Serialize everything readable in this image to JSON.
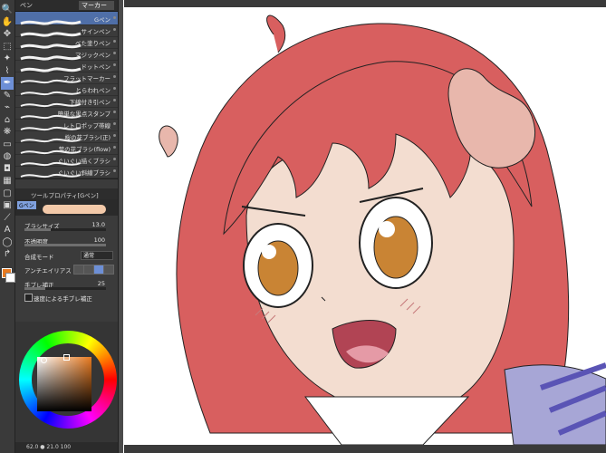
{
  "tools": [
    {
      "icon": "zoom-icon",
      "glyph": "🔍"
    },
    {
      "icon": "hand-icon",
      "glyph": "✋"
    },
    {
      "icon": "move-icon",
      "glyph": "✥"
    },
    {
      "icon": "select-icon",
      "glyph": "⬚"
    },
    {
      "icon": "wand-icon",
      "glyph": "✦"
    },
    {
      "icon": "eyedropper-icon",
      "glyph": "⌇"
    },
    {
      "icon": "pen-icon",
      "glyph": "✒"
    },
    {
      "icon": "pencil-icon",
      "glyph": "✎"
    },
    {
      "icon": "brush-icon",
      "glyph": "⌁"
    },
    {
      "icon": "airbrush-icon",
      "glyph": "⌂"
    },
    {
      "icon": "decoration-icon",
      "glyph": "❋"
    },
    {
      "icon": "eraser-icon",
      "glyph": "▭"
    },
    {
      "icon": "blend-icon",
      "glyph": "◍"
    },
    {
      "icon": "fill-icon",
      "glyph": "◘"
    },
    {
      "icon": "gradient-icon",
      "glyph": "▦"
    },
    {
      "icon": "figure-icon",
      "glyph": "▢"
    },
    {
      "icon": "frame-icon",
      "glyph": "▣"
    },
    {
      "icon": "ruler-icon",
      "glyph": "⟋"
    },
    {
      "icon": "text-icon",
      "glyph": "A"
    },
    {
      "icon": "balloon-icon",
      "glyph": "◯"
    },
    {
      "icon": "correct-line-icon",
      "glyph": "↱"
    }
  ],
  "brush_panel": {
    "tabs": [
      "ペン",
      "マーカー"
    ],
    "brushes": [
      {
        "label": "Gペン"
      },
      {
        "label": "サインペン"
      },
      {
        "label": "べた塗りペン"
      },
      {
        "label": "マジックペン"
      },
      {
        "label": "ドットペン"
      },
      {
        "label": "フラットマーカー"
      },
      {
        "label": "とらわれペン"
      },
      {
        "label": "下線付き引ペン"
      },
      {
        "label": "簡単な黒点スタンプ"
      },
      {
        "label": "レトロポップ帯線"
      },
      {
        "label": "桜の花ブラシ(正)"
      },
      {
        "label": "葉の花ブラシ(flow)"
      },
      {
        "label": "ぐいぐい描くブラシ"
      },
      {
        "label": "ぐいぐい斜線ブラシ"
      }
    ]
  },
  "tool_property": {
    "header": "ツールプロパティ[Gペン]",
    "tab": "Gペン",
    "brush_size": {
      "label": "ブラシサイズ",
      "value": "13.0"
    },
    "opacity": {
      "label": "不透明度",
      "value": "100"
    },
    "blend_mode": {
      "label": "合成モード",
      "value": "通常"
    },
    "antialias": {
      "label": "アンチエイリアス"
    },
    "stabilization": {
      "label": "手ブレ補正",
      "value": "25"
    },
    "speed_stabilization": {
      "label": "速度による手ブレ補正"
    }
  },
  "color_wheel": {
    "selected": "#e87a20"
  },
  "status_bar": {
    "text": "62.0 ● 21.0 100"
  }
}
